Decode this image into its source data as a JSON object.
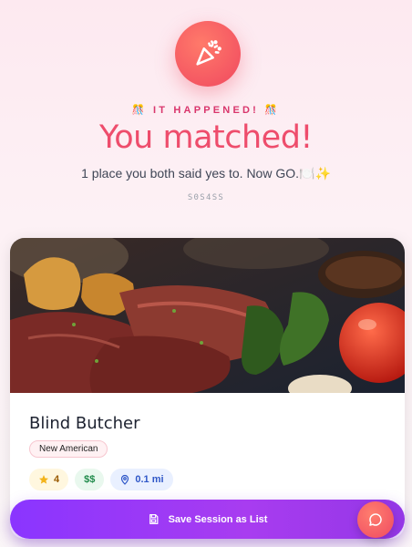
{
  "header": {
    "kicker": "🎊 IT HAPPENED! 🎊",
    "title": "You matched!",
    "subtitle": "1 place you both said yes to. Now GO.🍽️✨",
    "session_code": "S0S4SS",
    "badge_icon": "party-popper-icon"
  },
  "restaurant": {
    "name": "Blind Butcher",
    "cuisine": "New American",
    "rating": "4",
    "price": "$$",
    "distance": "0.1 mi",
    "photo_icon": "steak-photo"
  },
  "actions": {
    "save_label": "Save Session as List",
    "save_icon": "save-icon",
    "chat_icon": "chat-icon"
  },
  "colors": {
    "accent": "#ee4d6c",
    "kicker": "#d9366c",
    "save_gradient_start": "#8a35ff",
    "save_gradient_end": "#9437e6"
  }
}
